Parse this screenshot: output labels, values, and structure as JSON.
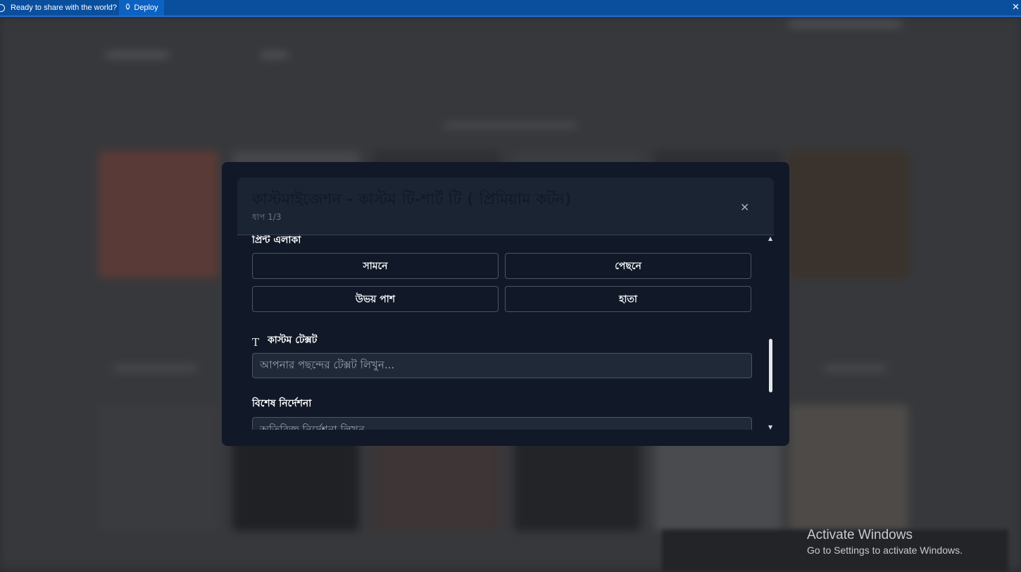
{
  "topbar": {
    "ready_text": "Ready to share with the world?",
    "deploy_label": "Deploy",
    "close_glyph": "✕",
    "deploy_icon": "rocket-icon"
  },
  "modal": {
    "title": "কাস্টমাইজেশন - কাস্টম টি-শার্ট টি ( প্রিমিয়াম কটন)",
    "step": "ধাপ 1/3",
    "close_glyph": "×",
    "print_area": {
      "label": "প্রিন্ট এলাকা",
      "options": [
        "সামনে",
        "পেছনে",
        "উভয় পাশ",
        "হাতা"
      ]
    },
    "custom_text": {
      "icon_glyph": "T",
      "label": "কাস্টম টেক্সট",
      "placeholder": "আপনার পছন্দের টেক্সট লিখুন..."
    },
    "special_instructions": {
      "label": "বিশেষ নির্দেশনা",
      "placeholder": "অতিরিক্ত নির্দেশনা লিখুন"
    },
    "scroll": {
      "up_glyph": "▲",
      "down_glyph": "▼"
    }
  },
  "watermark": {
    "line1": "Activate Windows",
    "line2": "Go to Settings to activate Windows."
  },
  "colors": {
    "topbar": "#0a4f9e",
    "modal_bg": "#111827",
    "field_bg": "#1f2937",
    "border": "#4b5563"
  }
}
